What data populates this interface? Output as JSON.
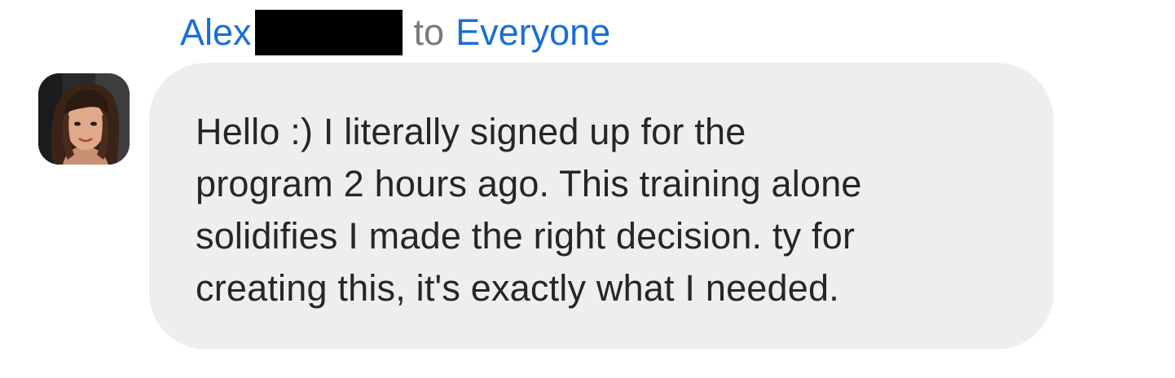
{
  "message": {
    "sender": "Alex",
    "to_label": "to",
    "recipient": "Everyone",
    "lines": [
      "Hello :) I literally signed up for the",
      "program 2 hours ago. This training alone",
      "solidifies I made the right decision. ty for",
      "creating this, it's exactly what I needed."
    ]
  },
  "colors": {
    "name_blue": "#1a6fd6",
    "muted_gray": "#7a7a7e",
    "bubble_bg": "#eeeef1",
    "text": "#262629"
  },
  "icons": {
    "avatar": "profile-photo"
  }
}
